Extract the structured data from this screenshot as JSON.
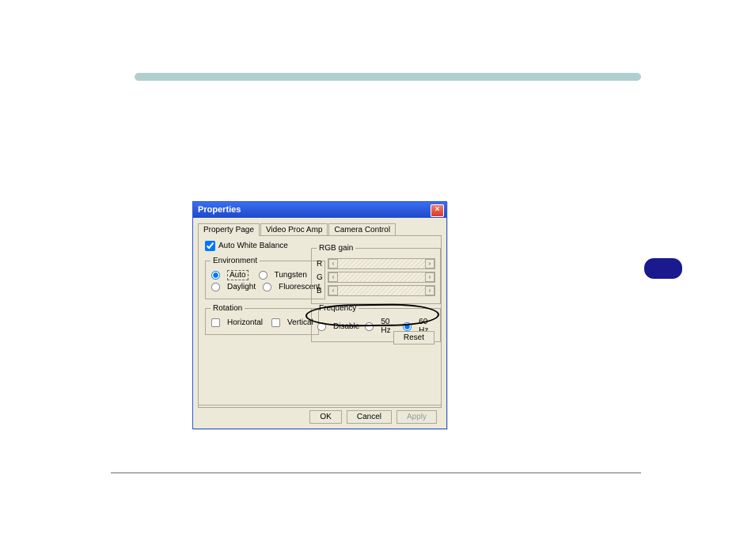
{
  "dialog": {
    "title": "Properties",
    "close_glyph": "×",
    "tabs": {
      "property_page": "Property Page",
      "video_proc_amp": "Video Proc Amp",
      "camera_control": "Camera Control"
    },
    "awb_label": "Auto White Balance",
    "environment": {
      "legend": "Environment",
      "auto": "Auto",
      "tungsten": "Tungsten",
      "daylight": "Daylight",
      "fluorescent": "Fluorescent"
    },
    "rotation": {
      "legend": "Rotation",
      "horizontal": "Horizontal",
      "vertical": "Vertical"
    },
    "rgb": {
      "legend": "RGB gain",
      "r": "R",
      "g": "G",
      "b": "B"
    },
    "frequency": {
      "legend": "Frequency",
      "disable": "Disable",
      "hz50": "50 Hz",
      "hz60": "60 Hz"
    },
    "reset": "Reset",
    "ok": "OK",
    "cancel": "Cancel",
    "apply": "Apply"
  }
}
